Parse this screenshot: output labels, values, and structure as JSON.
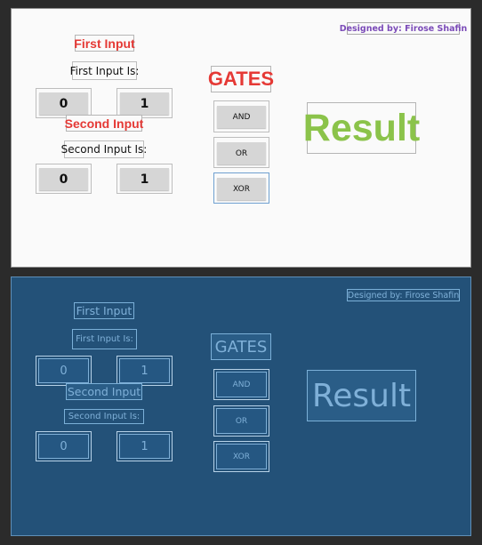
{
  "app": {
    "credit": "Designed by: Firose Shafin",
    "first_input_title": "First Input",
    "first_input_label": "First Input Is:",
    "second_input_title": "Second Input",
    "second_input_label": "Second Input Is:",
    "bit_zero": "0",
    "bit_one": "1",
    "gates_title": "GATES",
    "gates": [
      "AND",
      "OR",
      "XOR"
    ],
    "result": "Result"
  },
  "colors": {
    "title_red": "#e53935",
    "result_green": "#8bc34a",
    "credit_purple": "#7b4bb8",
    "blueprint_bg": "#235178",
    "blueprint_line": "#7fb0d8"
  }
}
